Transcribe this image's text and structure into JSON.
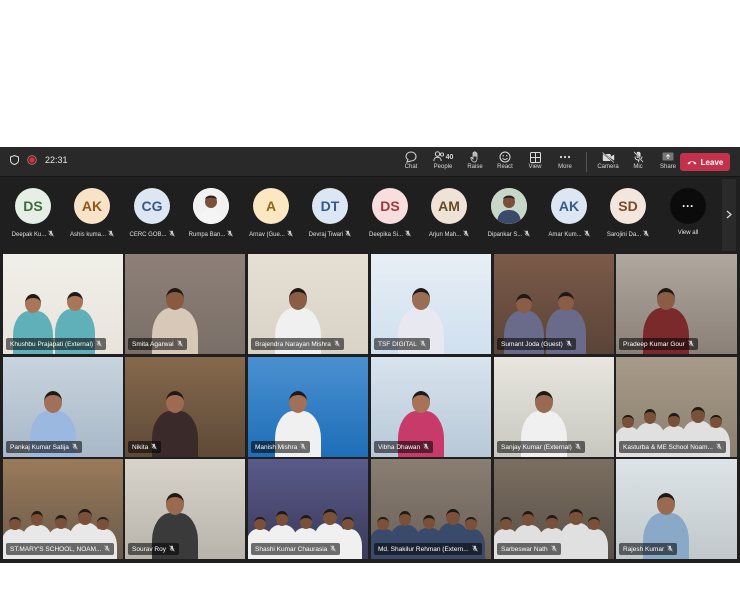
{
  "topbar": {
    "time": "22:31",
    "tools": [
      {
        "label": "Chat",
        "icon": "chat-icon"
      },
      {
        "label": "People",
        "icon": "people-icon",
        "count": "40"
      },
      {
        "label": "Raise",
        "icon": "hand-icon"
      },
      {
        "label": "React",
        "icon": "smile-icon"
      },
      {
        "label": "View",
        "icon": "grid-icon"
      },
      {
        "label": "More",
        "icon": "more-icon"
      }
    ],
    "devices": [
      {
        "label": "Camera",
        "icon": "camera-off-icon"
      },
      {
        "label": "Mic",
        "icon": "mic-off-icon"
      },
      {
        "label": "Share",
        "icon": "share-icon"
      }
    ],
    "leave_label": "Leave",
    "colors": {
      "leave": "#c4314b",
      "bar": "#292929"
    }
  },
  "strip": {
    "avatars": [
      {
        "initials": "DS",
        "name": "Deepak Ku...",
        "bg": "#e6efe6",
        "fg": "#3d6b3d"
      },
      {
        "initials": "AK",
        "name": "Ashis kuma...",
        "bg": "#f8e2c8",
        "fg": "#8a5a1a"
      },
      {
        "initials": "CG",
        "name": "CERC GOB...",
        "bg": "#dde6f3",
        "fg": "#3a5a85"
      },
      {
        "initials": "",
        "name": "Rumpa Ban...",
        "bg": "#f2f2f2",
        "fg": "#333",
        "photo": true
      },
      {
        "initials": "A",
        "name": "Arnav (Gue...",
        "bg": "#fbe8c2",
        "fg": "#8a6a1a"
      },
      {
        "initials": "DT",
        "name": "Devraj Tiwari",
        "bg": "#dde6f3",
        "fg": "#3a5a85"
      },
      {
        "initials": "DS",
        "name": "Deepika Si...",
        "bg": "#f8dede",
        "fg": "#9a3a3a"
      },
      {
        "initials": "AM",
        "name": "Arjun Mah...",
        "bg": "#efe3d8",
        "fg": "#6a4a2a"
      },
      {
        "initials": "",
        "name": "Dipankar S...",
        "bg": "#c8d8c8",
        "fg": "#333",
        "photo": true
      },
      {
        "initials": "AK",
        "name": "Amar Kum...",
        "bg": "#dde6f3",
        "fg": "#3a5a85"
      },
      {
        "initials": "SD",
        "name": "Sarojini Da...",
        "bg": "#f3e6dd",
        "fg": "#7a4a2a"
      }
    ],
    "view_all": "View all"
  },
  "grid": {
    "tiles": [
      {
        "name": "Khushbu Prajapati (External)",
        "bg": "#e8e4dc",
        "wall": "#f1efe9",
        "skin": "#a8775a",
        "shirt": "#5fb0b8"
      },
      {
        "name": "Smita Agarwal",
        "bg": "#7a6f68",
        "wall": "#8e8079",
        "skin": "#8a5a40",
        "shirt": "#d8c8b8"
      },
      {
        "name": "Brajendra Narayan Mishra",
        "bg": "#d9d2c6",
        "wall": "#e6dfd4",
        "skin": "#8a5d44",
        "shirt": "#f0f0f0"
      },
      {
        "name": "TSF DIGITAL",
        "bg": "#cfe0f0",
        "wall": "#e8eef5",
        "skin": "#9a6d55",
        "shirt": "#e8e8f0"
      },
      {
        "name": "Sumant Joda (Guest)",
        "bg": "#5a4438",
        "wall": "#7b5a48",
        "skin": "#8a5d44",
        "shirt": "#6a6a8a"
      },
      {
        "name": "Pradeep Kumar Gour",
        "bg": "#8a8078",
        "wall": "#b0a89e",
        "skin": "#8a5d44",
        "shirt": "#7a2a2a"
      },
      {
        "name": "Pankaj Kumar Satija",
        "bg": "#a8b8c8",
        "wall": "#c8d4de",
        "skin": "#a07058",
        "shirt": "#9ab8e0"
      },
      {
        "name": "Nikita",
        "bg": "#5e4a38",
        "wall": "#86684c",
        "skin": "#a06a50",
        "shirt": "#3a2a2a"
      },
      {
        "name": "Manish Mishra",
        "bg": "#1e6eb8",
        "wall": "#4a90d0",
        "skin": "#a07058",
        "shirt": "#f0f0f0"
      },
      {
        "name": "Vibha Dhawan",
        "bg": "#b8c8d8",
        "wall": "#d8e4ee",
        "skin": "#a87258",
        "shirt": "#c83a6a"
      },
      {
        "name": "Sanjay Kumar (External)",
        "bg": "#c8c8c0",
        "wall": "#e8e6de",
        "skin": "#9a6a50",
        "shirt": "#f0f0f0"
      },
      {
        "name": "Kasturba & ME School Noam...",
        "bg": "#8a8070",
        "wall": "#a89a88",
        "skin": "#7a5038",
        "shirt": "#e0e0e0"
      },
      {
        "name": "ST.MARY'S SCHOOL, NOAM...",
        "bg": "#6a5a4a",
        "wall": "#9a7a5a",
        "skin": "#7a5038",
        "shirt": "#e8e8e8"
      },
      {
        "name": "Sourav Roy",
        "bg": "#b8b4ac",
        "wall": "#d8d4cc",
        "skin": "#9a6a50",
        "shirt": "#3a3a3a"
      },
      {
        "name": "Shashi Kumar Chaurasia",
        "bg": "#3a3a5a",
        "wall": "#5a5a8a",
        "skin": "#7a5038",
        "shirt": "#f0f0f0"
      },
      {
        "name": "Md. Shakilur Rehman (Extern...",
        "bg": "#6a6058",
        "wall": "#8a7e72",
        "skin": "#7a5038",
        "shirt": "#3a4a6a"
      },
      {
        "name": "Sarbeswar Nath",
        "bg": "#5a5048",
        "wall": "#7a6e60",
        "skin": "#7a5038",
        "shirt": "#e0e0e0"
      },
      {
        "name": "Rajesh Kumar",
        "bg": "#c0c8cc",
        "wall": "#dde4e8",
        "skin": "#9a6a50",
        "shirt": "#8aa8c8"
      }
    ]
  }
}
